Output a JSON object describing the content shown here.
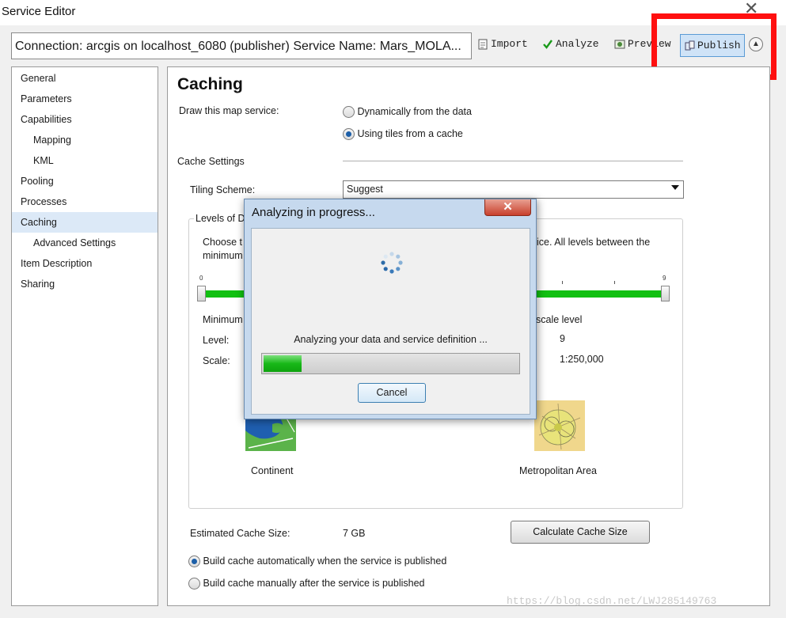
{
  "window": {
    "title": "Service Editor"
  },
  "header": {
    "connection_text": "Connection: arcgis on localhost_6080 (publisher)   Service Name: Mars_MOLA...",
    "toolbar": {
      "import": "Import",
      "analyze": "Analyze",
      "preview": "Preview",
      "publish": "Publish"
    }
  },
  "sidebar": {
    "items": [
      {
        "label": "General"
      },
      {
        "label": "Parameters"
      },
      {
        "label": "Capabilities"
      },
      {
        "label": "Mapping"
      },
      {
        "label": "KML"
      },
      {
        "label": "Pooling"
      },
      {
        "label": "Processes"
      },
      {
        "label": "Caching"
      },
      {
        "label": "Advanced Settings"
      },
      {
        "label": "Item Description"
      },
      {
        "label": "Sharing"
      }
    ]
  },
  "caching": {
    "title": "Caching",
    "draw_label": "Draw this map service:",
    "opt_dynamic": "Dynamically from the data",
    "opt_tiles": "Using tiles from a cache",
    "cache_settings": "Cache Settings",
    "tiling_label": "Tiling Scheme:",
    "tiling_value": "Suggest",
    "levels_legend": "Levels of D",
    "choose_text_left": "Choose t",
    "choose_text_left2": "minimum",
    "choose_text_right": "ice. All levels between the",
    "tick_min": "0",
    "tick_max": "9",
    "minimum_label": "Minimum",
    "max_scale_label": "scale level",
    "level_label": "Level:",
    "level_value": "9",
    "scale_label": "Scale:",
    "scale_value": "1:250,000",
    "continent_label": "Continent",
    "metro_label": "Metropolitan Area",
    "estimated_label": "Estimated Cache Size:",
    "estimated_value": "7 GB",
    "calc_button": "Calculate Cache Size",
    "build_auto": "Build cache automatically when the service is published",
    "build_manual": "Build cache manually after the service is published"
  },
  "dialog": {
    "title": "Analyzing in progress...",
    "message": "Analyzing your data and service definition ...",
    "progress": 0.15,
    "cancel": "Cancel"
  },
  "watermark": "https://blog.csdn.net/LWJ285149763",
  "colors": {
    "accent_highlight": "#ff1010",
    "slider": "#11c011",
    "selected_nav": "#dce9f7"
  }
}
